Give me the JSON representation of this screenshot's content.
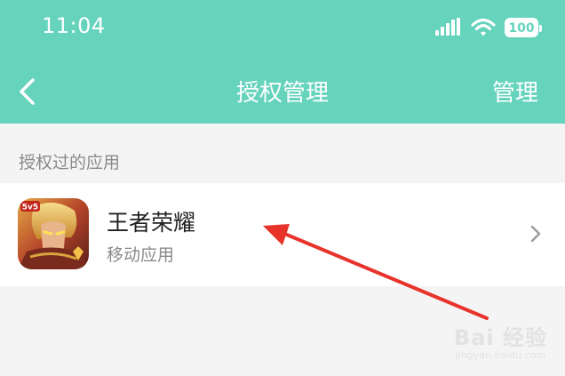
{
  "status_bar": {
    "time": "11:04",
    "battery": "100"
  },
  "nav": {
    "title": "授权管理",
    "manage_label": "管理"
  },
  "section": {
    "label": "授权过的应用"
  },
  "apps": [
    {
      "name": "王者荣耀",
      "type": "移动应用",
      "icon": "honor-of-kings-app-icon"
    }
  ],
  "watermark": {
    "main": "Bai 经验",
    "sub": "jingyan.baidu.com"
  },
  "colors": {
    "header": "#66d3bd",
    "background": "#f4f4f5",
    "arrow": "#e8332b"
  }
}
